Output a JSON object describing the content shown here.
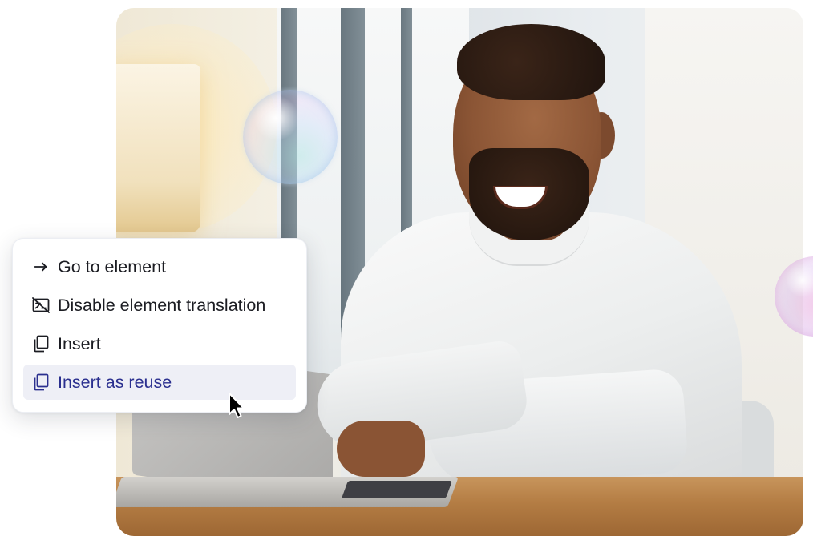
{
  "menu": {
    "items": [
      {
        "label": "Go to element",
        "icon": "arrow-right-icon"
      },
      {
        "label": "Disable element translation",
        "icon": "translation-off-icon"
      },
      {
        "label": "Insert",
        "icon": "copy-icon"
      },
      {
        "label": "Insert as reuse",
        "icon": "copy-icon",
        "active": true
      }
    ]
  },
  "colors": {
    "active_bg": "#eeeff6",
    "active_text": "#2a2f8f",
    "text": "#1b1c22"
  },
  "cursor": {
    "icon": "mouse-pointer-icon"
  }
}
